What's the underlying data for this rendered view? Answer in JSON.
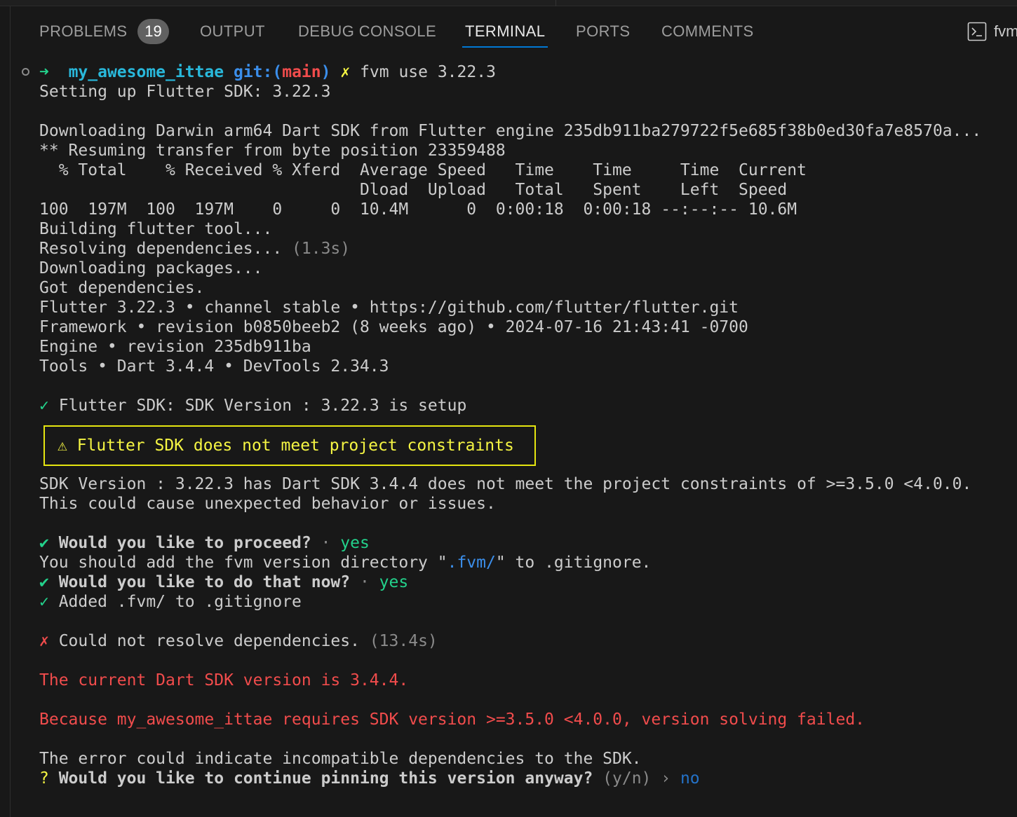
{
  "panel": {
    "tabs": [
      {
        "label": "PROBLEMS",
        "badge": "19"
      },
      {
        "label": "OUTPUT"
      },
      {
        "label": "DEBUG CONSOLE"
      },
      {
        "label": "TERMINAL",
        "active": true
      },
      {
        "label": "PORTS"
      },
      {
        "label": "COMMENTS"
      }
    ],
    "shell_label": "fvm"
  },
  "terminal": {
    "prompt": {
      "arrow": "➜",
      "dir": "my_awesome_ittae",
      "git_prefix": "git:(",
      "branch": "main",
      "git_suffix": ")",
      "dirty": "✗",
      "command": "fvm use 3.22.3"
    },
    "setup_line": "Setting up Flutter SDK: 3.22.3",
    "download_line": "Downloading Darwin arm64 Dart SDK from Flutter engine 235db911ba279722f5e685f38b0ed30fa7e8570a...",
    "resume_line": "** Resuming transfer from byte position 23359488",
    "curl_header_1": "  % Total    % Received % Xferd  Average Speed   Time    Time     Time  Current",
    "curl_header_2": "                                 Dload  Upload   Total   Spent    Left  Speed",
    "curl_row": "100  197M  100  197M    0     0  10.4M      0  0:00:18  0:00:18 --:--:-- 10.6M",
    "building_line": "Building flutter tool...",
    "resolving_text": "Resolving dependencies... ",
    "resolving_time": "(1.3s)",
    "downloading_packages": "Downloading packages...",
    "got_deps": "Got dependencies.",
    "flutter_info": "Flutter 3.22.3 • channel stable • https://github.com/flutter/flutter.git",
    "framework_info": "Framework • revision b0850beeb2 (8 weeks ago) • 2024-07-16 21:43:41 -0700",
    "engine_info": "Engine • revision 235db911ba",
    "tools_info": "Tools • Dart 3.4.4 • DevTools 2.34.3",
    "check_mark": "✓",
    "sdk_setup": " Flutter SDK: SDK Version : 3.22.3 is setup",
    "warning_icon": "⚠",
    "warning_text": " Flutter SDK does not meet project constraints",
    "constraint_line_1": "SDK Version : 3.22.3 has Dart SDK 3.4.4 does not meet the project constraints of >=3.5.0 <4.0.0.",
    "constraint_line_2": "This could cause unexpected behavior or issues.",
    "heavy_check": "✔",
    "proceed_question": " Would you like to proceed?",
    "separator_dot": " · ",
    "proceed_answer": "yes",
    "gitignore_prefix": "You should add the fvm version directory \"",
    "gitignore_dir": ".fvm/",
    "gitignore_suffix": "\" to .gitignore.",
    "do_now_question": " Would you like to do that now?",
    "do_now_answer": "yes",
    "added_text": " Added .fvm/ to .gitignore",
    "cross_mark": "✗",
    "resolve_fail": " Could not resolve dependencies. ",
    "resolve_fail_time": "(13.4s)",
    "error_line_1": "The current Dart SDK version is 3.4.4.",
    "error_line_2": "Because my_awesome_ittae requires SDK version >=3.5.0 <4.0.0, version solving failed.",
    "incompatible_line": "The error could indicate incompatible dependencies to the SDK.",
    "question_mark": "?",
    "pin_question": " Would you like to continue pinning this version anyway?",
    "pin_hint": " (y/n) ",
    "pin_chevron": "›",
    "pin_answer": " no"
  },
  "colors": {
    "background": "#181818",
    "text": "#cccccc",
    "green": "#23d18b",
    "cyan": "#29b8db",
    "red": "#f14c4c",
    "yellow": "#f5f543",
    "active_tab_underline": "#0078d4",
    "badge": "#616161"
  }
}
